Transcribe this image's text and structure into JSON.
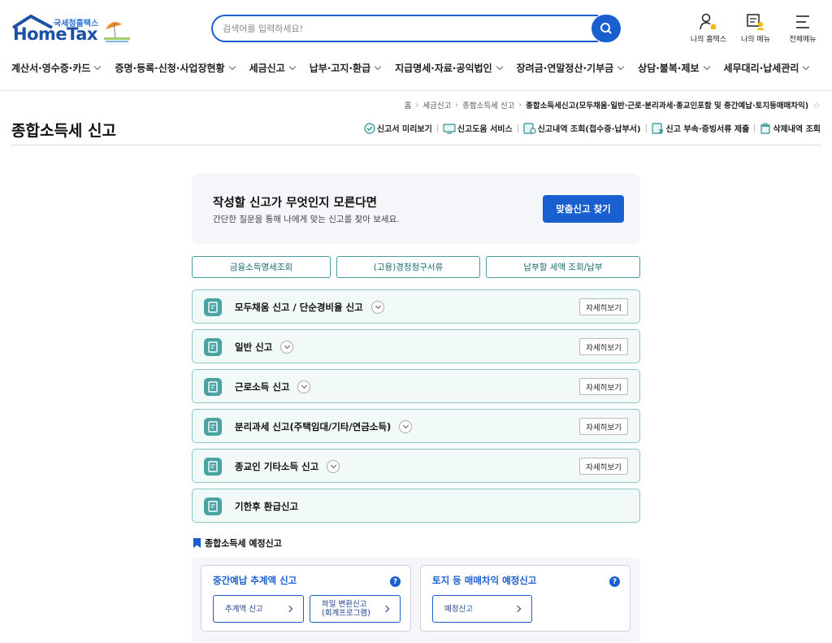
{
  "logo": {
    "small_text": "국세청홈택스",
    "main_text": "HomeTax"
  },
  "search": {
    "placeholder": "검색어를 입력하세요!"
  },
  "top_icons": [
    {
      "label": "나의 홈택스",
      "icon": "user-bell-icon"
    },
    {
      "label": "나의 메뉴",
      "icon": "my-menu-icon"
    },
    {
      "label": "전체메뉴",
      "icon": "hamburger-icon"
    }
  ],
  "gnb": [
    "계산서·영수증·카드",
    "증명·등록·신청·사업장현황",
    "세금신고",
    "납부·고지·환급",
    "지급명세·자료·공익법인",
    "장려금·연말정산·기부금",
    "상담·불복·제보",
    "세무대리·납세관리"
  ],
  "breadcrumb": {
    "items": [
      "홈",
      "세금신고",
      "종합소득세 신고"
    ],
    "current": "종합소득세신고(모두채움·일반·근로·분리과세·종교인포함 및 중간예납·토지등매매차익)"
  },
  "page": {
    "title": "종합소득세 신고"
  },
  "util_links": [
    {
      "label": "신고서 미리보기",
      "icon": "preview-icon"
    },
    {
      "label": "신고도움 서비스",
      "icon": "help-service-icon"
    },
    {
      "label": "신고내역 조회(접수증·납부서)",
      "icon": "history-icon"
    },
    {
      "label": "신고 부속·증빙서류 제출",
      "icon": "attach-icon"
    },
    {
      "label": "삭제내역 조회",
      "icon": "trash-icon"
    }
  ],
  "finder": {
    "title": "작성할 신고가 무엇인지 모른다면",
    "desc": "간단한 질문을 통해 나에게 맞는 신고를 찾아 보세요.",
    "button": "맞춤신고 찾기"
  },
  "quick_buttons": [
    "금융소득명세조회",
    "(고용)경정청구서류",
    "납부할 세액 조회/납부"
  ],
  "accordions": [
    {
      "label": "모두채움 신고 / 단순경비율 신고",
      "has_toggle": true,
      "more": "자세히보기"
    },
    {
      "label": "일반 신고",
      "has_toggle": true,
      "more": "자세히보기"
    },
    {
      "label": "근로소득 신고",
      "has_toggle": true,
      "more": "자세히보기"
    },
    {
      "label": "분리과세 신고(주택임대/기타/연금소득)",
      "has_toggle": true,
      "more": "자세히보기"
    },
    {
      "label": "종교인 기타소득 신고",
      "has_toggle": true,
      "more": "자세히보기"
    },
    {
      "label": "기한후 환급신고",
      "has_toggle": false,
      "more": ""
    }
  ],
  "estimated": {
    "heading": "종합소득세 예정신고",
    "cards": [
      {
        "title": "중간예납 추계액 신고",
        "buttons": [
          {
            "line1": "추계액 신고",
            "line2": ""
          },
          {
            "line1": "파일 변환신고",
            "line2": "(회계프로그램)"
          }
        ]
      },
      {
        "title": "토지 등 매매차익 예정신고",
        "buttons": [
          {
            "line1": "예정신고",
            "line2": ""
          }
        ]
      }
    ]
  },
  "colors": {
    "primary": "#1a5fd0",
    "teal": "#4aa3a3",
    "teal_border": "#8cc5c5"
  }
}
